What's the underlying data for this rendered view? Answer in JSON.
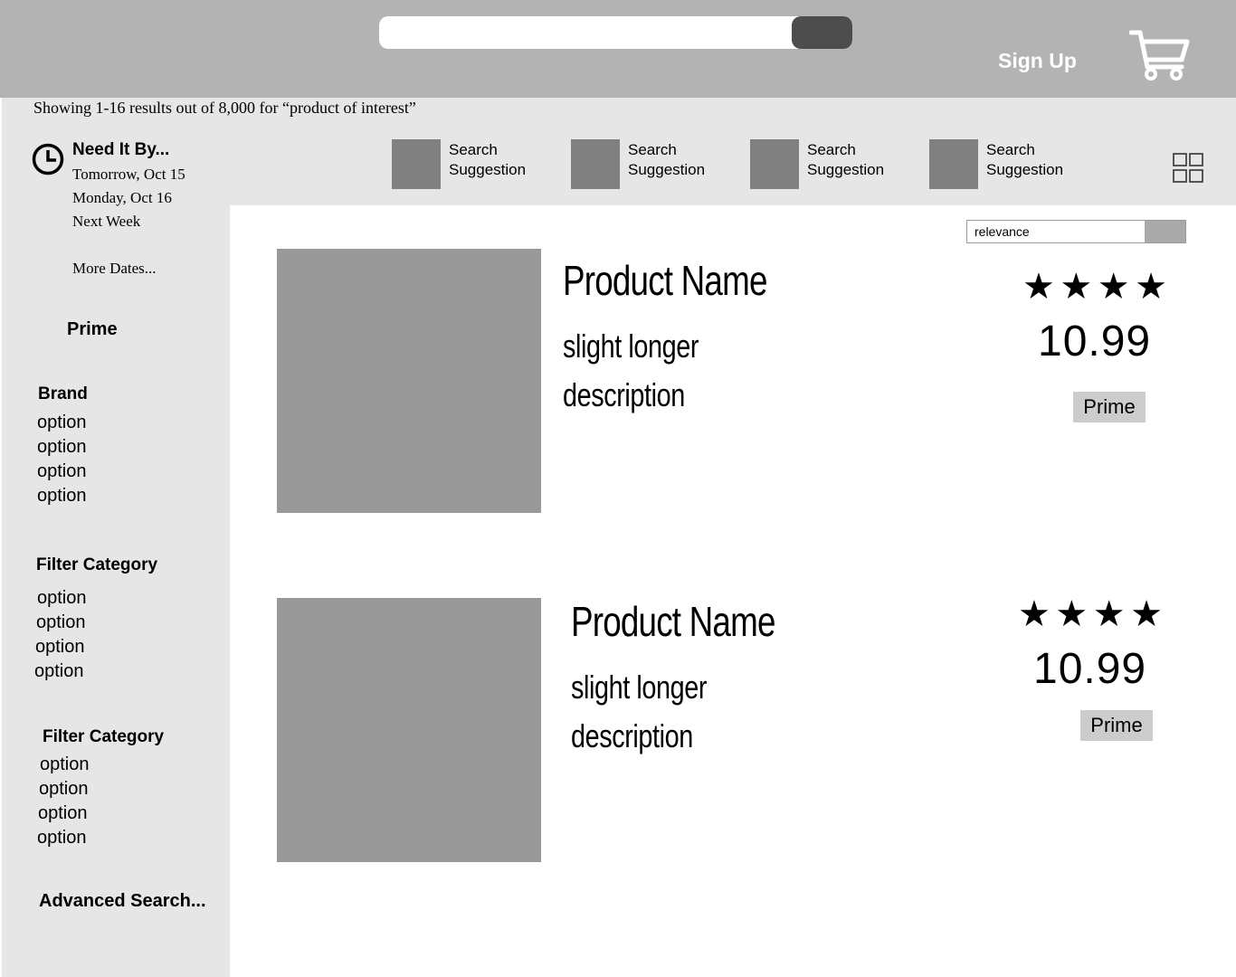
{
  "header": {
    "sign_up_label": "Sign Up"
  },
  "results": {
    "count_text": "Showing 1-16 results out of 8,000 for “product of interest”"
  },
  "sidebar": {
    "need_it_by": {
      "title": "Need It By...",
      "dates": [
        "Tomorrow, Oct 15",
        "Monday, Oct 16",
        "Next Week"
      ],
      "more": "More Dates..."
    },
    "prime_label": "Prime",
    "sections": [
      {
        "title": "Brand",
        "options": [
          "option",
          "option",
          "option",
          "option"
        ]
      },
      {
        "title": "Filter Category",
        "options": [
          "option",
          "option",
          "option",
          "option"
        ]
      },
      {
        "title": "Filter Category",
        "options": [
          "option",
          "option",
          "option",
          "option"
        ]
      }
    ],
    "advanced_search": "Advanced Search..."
  },
  "suggestions": [
    {
      "label": "Search Suggestion"
    },
    {
      "label": "Search Suggestion"
    },
    {
      "label": "Search Suggestion"
    },
    {
      "label": "Search Suggestion"
    }
  ],
  "sort": {
    "selected": "relevance"
  },
  "products": [
    {
      "name": "Product Name",
      "desc_line1": "slight longer",
      "desc_line2": "description",
      "rating": 4,
      "price": "10.99",
      "badge": "Prime"
    },
    {
      "name": "Product Name",
      "desc_line1": "slight longer",
      "desc_line2": "description",
      "rating": 4,
      "price": "10.99",
      "badge": "Prime"
    }
  ],
  "icons": {
    "cart": "cart-icon",
    "clock": "clock-icon",
    "grid": "grid-view-icon",
    "star": "star-icon"
  },
  "colors": {
    "header_bg": "#b3b3b3",
    "panel_bg": "#e6e6e6",
    "image_placeholder": "#999999",
    "search_button": "#4d4d4d"
  }
}
